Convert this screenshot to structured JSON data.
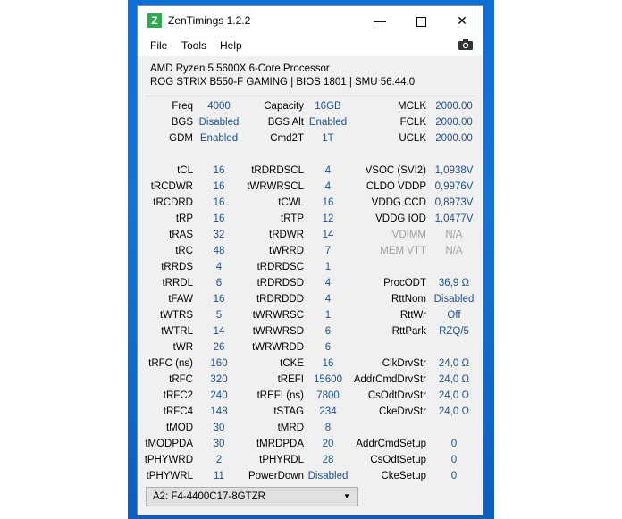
{
  "window": {
    "title": "ZenTimings 1.2.2",
    "app_icon_letter": "Z"
  },
  "menu": {
    "items": [
      "File",
      "Tools",
      "Help"
    ]
  },
  "system": {
    "cpu": "AMD Ryzen 5 5600X 6-Core Processor",
    "board": "ROG STRIX B550-F GAMING | BIOS 1801 | SMU 56.44.0"
  },
  "rows": [
    [
      [
        "Freq",
        "4000"
      ],
      [
        "Capacity",
        "16GB"
      ],
      [
        "MCLK",
        "2000.00"
      ]
    ],
    [
      [
        "BGS",
        "Disabled"
      ],
      [
        "BGS Alt",
        "Enabled"
      ],
      [
        "FCLK",
        "2000.00"
      ]
    ],
    [
      [
        "GDM",
        "Enabled"
      ],
      [
        "Cmd2T",
        "1T"
      ],
      [
        "UCLK",
        "2000.00"
      ]
    ],
    [
      [
        "",
        ""
      ],
      [
        "",
        ""
      ],
      [
        "",
        ""
      ]
    ],
    [
      [
        "tCL",
        "16"
      ],
      [
        "tRDRDSCL",
        "4"
      ],
      [
        "VSOC (SVI2)",
        "1,0938V"
      ]
    ],
    [
      [
        "tRCDWR",
        "16"
      ],
      [
        "tWRWRSCL",
        "4"
      ],
      [
        "CLDO VDDP",
        "0,9976V"
      ]
    ],
    [
      [
        "tRCDRD",
        "16"
      ],
      [
        "tCWL",
        "16"
      ],
      [
        "VDDG CCD",
        "0,8973V"
      ]
    ],
    [
      [
        "tRP",
        "16"
      ],
      [
        "tRTP",
        "12"
      ],
      [
        "VDDG IOD",
        "1,0477V"
      ]
    ],
    [
      [
        "tRAS",
        "32"
      ],
      [
        "tRDWR",
        "14"
      ],
      [
        "VDIMM",
        "N/A"
      ]
    ],
    [
      [
        "tRC",
        "48"
      ],
      [
        "tWRRD",
        "7"
      ],
      [
        "MEM VTT",
        "N/A"
      ]
    ],
    [
      [
        "tRRDS",
        "4"
      ],
      [
        "tRDRDSC",
        "1"
      ],
      [
        "",
        ""
      ]
    ],
    [
      [
        "tRRDL",
        "6"
      ],
      [
        "tRDRDSD",
        "4"
      ],
      [
        "ProcODT",
        "36,9 Ω"
      ]
    ],
    [
      [
        "tFAW",
        "16"
      ],
      [
        "tRDRDDD",
        "4"
      ],
      [
        "RttNom",
        "Disabled"
      ]
    ],
    [
      [
        "tWTRS",
        "5"
      ],
      [
        "tWRWRSC",
        "1"
      ],
      [
        "RttWr",
        "Off"
      ]
    ],
    [
      [
        "tWTRL",
        "14"
      ],
      [
        "tWRWRSD",
        "6"
      ],
      [
        "RttPark",
        "RZQ/5"
      ]
    ],
    [
      [
        "tWR",
        "26"
      ],
      [
        "tWRWRDD",
        "6"
      ],
      [
        "",
        ""
      ]
    ],
    [
      [
        "tRFC (ns)",
        "160"
      ],
      [
        "tCKE",
        "16"
      ],
      [
        "ClkDrvStr",
        "24,0 Ω"
      ]
    ],
    [
      [
        "tRFC",
        "320"
      ],
      [
        "tREFI",
        "15600"
      ],
      [
        "AddrCmdDrvStr",
        "24,0 Ω"
      ]
    ],
    [
      [
        "tRFC2",
        "240"
      ],
      [
        "tREFI (ns)",
        "7800"
      ],
      [
        "CsOdtDrvStr",
        "24,0 Ω"
      ]
    ],
    [
      [
        "tRFC4",
        "148"
      ],
      [
        "tSTAG",
        "234"
      ],
      [
        "CkeDrvStr",
        "24,0 Ω"
      ]
    ],
    [
      [
        "tMOD",
        "30"
      ],
      [
        "tMRD",
        "8"
      ],
      [
        "",
        ""
      ]
    ],
    [
      [
        "tMODPDA",
        "30"
      ],
      [
        "tMRDPDA",
        "20"
      ],
      [
        "AddrCmdSetup",
        "0"
      ]
    ],
    [
      [
        "tPHYWRD",
        "2"
      ],
      [
        "tPHYRDL",
        "28"
      ],
      [
        "CsOdtSetup",
        "0"
      ]
    ],
    [
      [
        "tPHYWRL",
        "11"
      ],
      [
        "PowerDown",
        "Disabled"
      ],
      [
        "CkeSetup",
        "0"
      ]
    ]
  ],
  "dim_labels": [
    "VDIMM",
    "MEM VTT"
  ],
  "module_selector": {
    "selected": "A2: F4-4400C17-8GTZR"
  },
  "colors": {
    "value_text": "#1e4f8f",
    "dim_text": "#a0a0a0",
    "desktop_blue": "#0a6fd6",
    "app_icon": "#2fa84f"
  }
}
